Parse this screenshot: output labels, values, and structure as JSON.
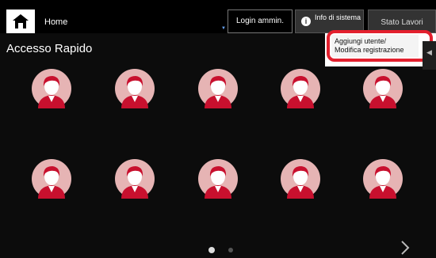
{
  "header": {
    "home_label": "Home",
    "login_label": "Login ammin.",
    "info_label": "Info di sistema",
    "stato_label": "Stato Lavori"
  },
  "dropdown": {
    "item_line1": "Aggiungi utente/",
    "item_line2": "Modifica registrazione"
  },
  "page": {
    "title": "Accesso Rapido"
  },
  "user_grid": {
    "rows": 2,
    "columns": 5,
    "count": 10
  },
  "pagination": {
    "current_page": 1,
    "total_pages": 2
  },
  "icons": [
    "home-icon",
    "info-icon",
    "user-avatar-icon",
    "next-arrow-icon",
    "side-tab-arrow-icon"
  ],
  "colors": {
    "highlight": "#e3202e",
    "avatar_circle": "#e6b4b4",
    "avatar_figure": "#c8102e"
  }
}
